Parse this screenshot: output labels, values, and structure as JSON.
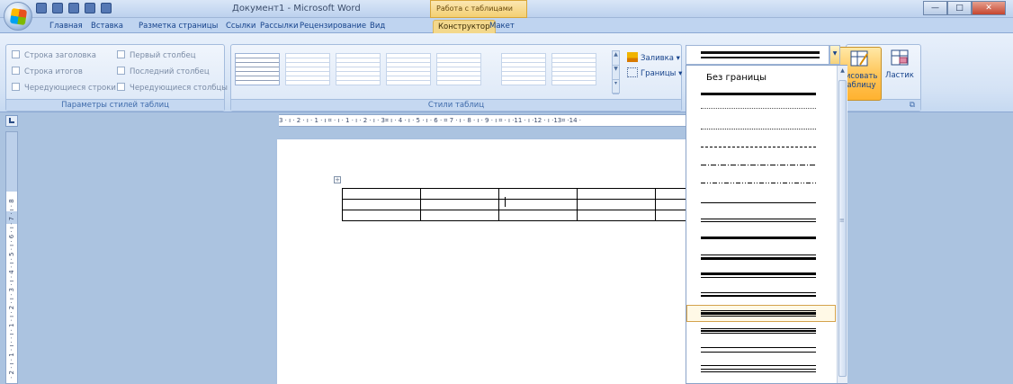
{
  "window": {
    "title": "Документ1 - Microsoft Word",
    "context_tab": "Работа с таблицами",
    "controls": {
      "minimize": "—",
      "maximize": "□",
      "close": "✕"
    }
  },
  "tabs": [
    "Главная",
    "Вставка",
    "Разметка страницы",
    "Ссылки",
    "Рассылки",
    "Рецензирование",
    "Вид",
    "Конструктор",
    "Макет"
  ],
  "active_tab": "Конструктор",
  "ribbon": {
    "table_style_options": {
      "label": "Параметры стилей таблиц",
      "options": [
        "Строка заголовка",
        "Первый столбец",
        "Строка итогов",
        "Последний столбец",
        "Чередующиеся строки",
        "Чередующиеся столбцы"
      ]
    },
    "table_styles": {
      "label": "Стили таблиц"
    },
    "shading_label": "Заливка",
    "borders_label": "Границы",
    "draw_table_label": "рисовать\nтаблицу",
    "eraser_label": "Ластик"
  },
  "ruler": {
    "horizontal": "3 · ı · 2 · ı · 1 · ı ⌗ · ı · 1 · ı · 2 · ı · 3⌗ ı · 4 · ı · 5 · ı · 6 · ⌗ 7 · ı · 8 · ı · 9 · ı ⌗ · ı ·11 · ı ·12 · ı ·13⌗ ·14 ·",
    "vertical": "· 2 · ı · 1 · ı · · ı · 1 · ı · 2 · ı · 3 · ı · 4 · ı · 5 · ı · 6 · ı · 7 · ı · 8"
  },
  "border_dropdown": {
    "no_border_label": "Без границы",
    "selected_index": 12
  },
  "colors": {
    "accent": "#f3d88c",
    "ribbon_bg": "#dbe7f7",
    "workspace_bg": "#abc3e0"
  }
}
